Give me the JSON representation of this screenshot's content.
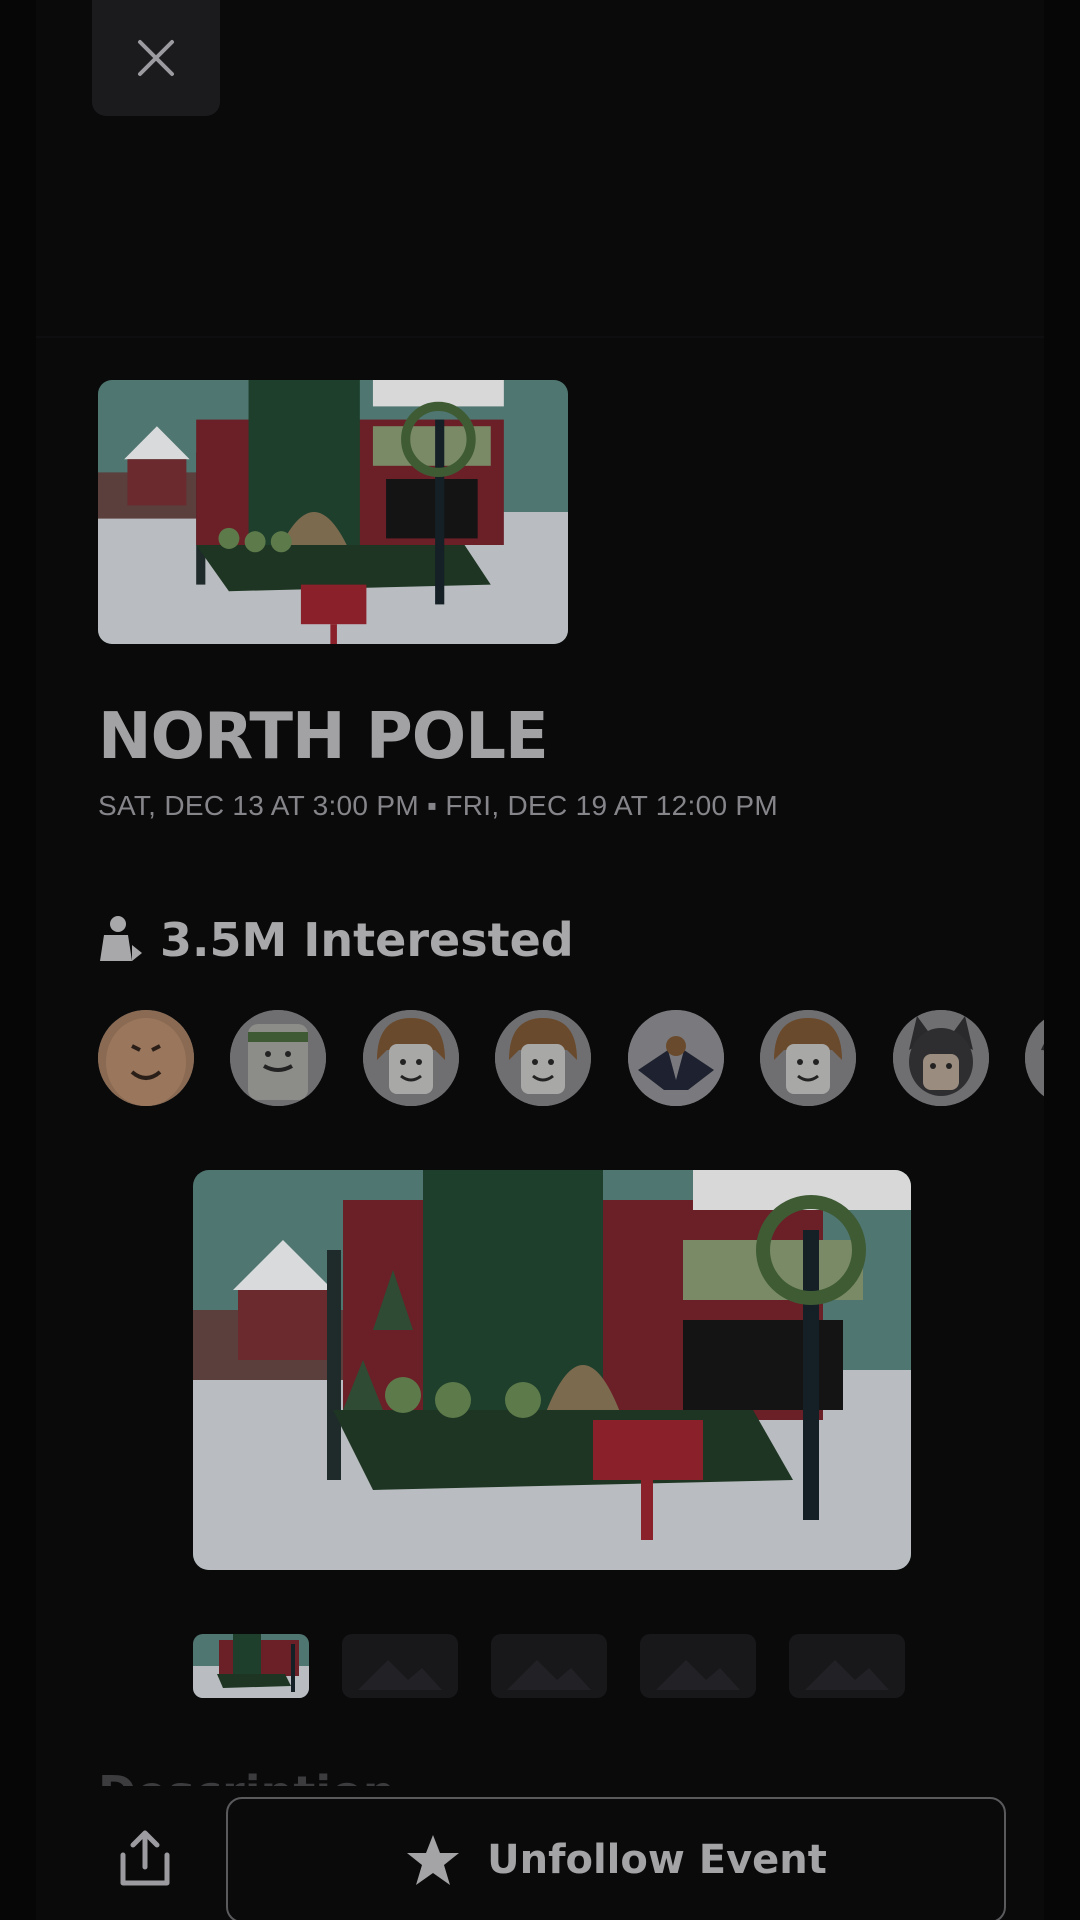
{
  "event": {
    "title": "NORTH POLE",
    "dates": "SAT, DEC 13 AT 3:00 PM ▪ FRI, DEC 19 AT 12:00 PM",
    "interested": "3.5M Interested"
  },
  "gallery": {
    "thumbnail_count": 5,
    "active_index": 0
  },
  "description": {
    "heading": "Description"
  },
  "actions": {
    "unfollow_label": "Unfollow Event"
  },
  "icons": {
    "close": "close-icon",
    "interested": "person-icon",
    "share": "share-icon",
    "star": "star-icon",
    "image_placeholder": "image-placeholder-icon"
  },
  "colors": {
    "background": "#0a0a0b",
    "text": "#a2a2a4",
    "button_border": "#5a5a5d"
  }
}
